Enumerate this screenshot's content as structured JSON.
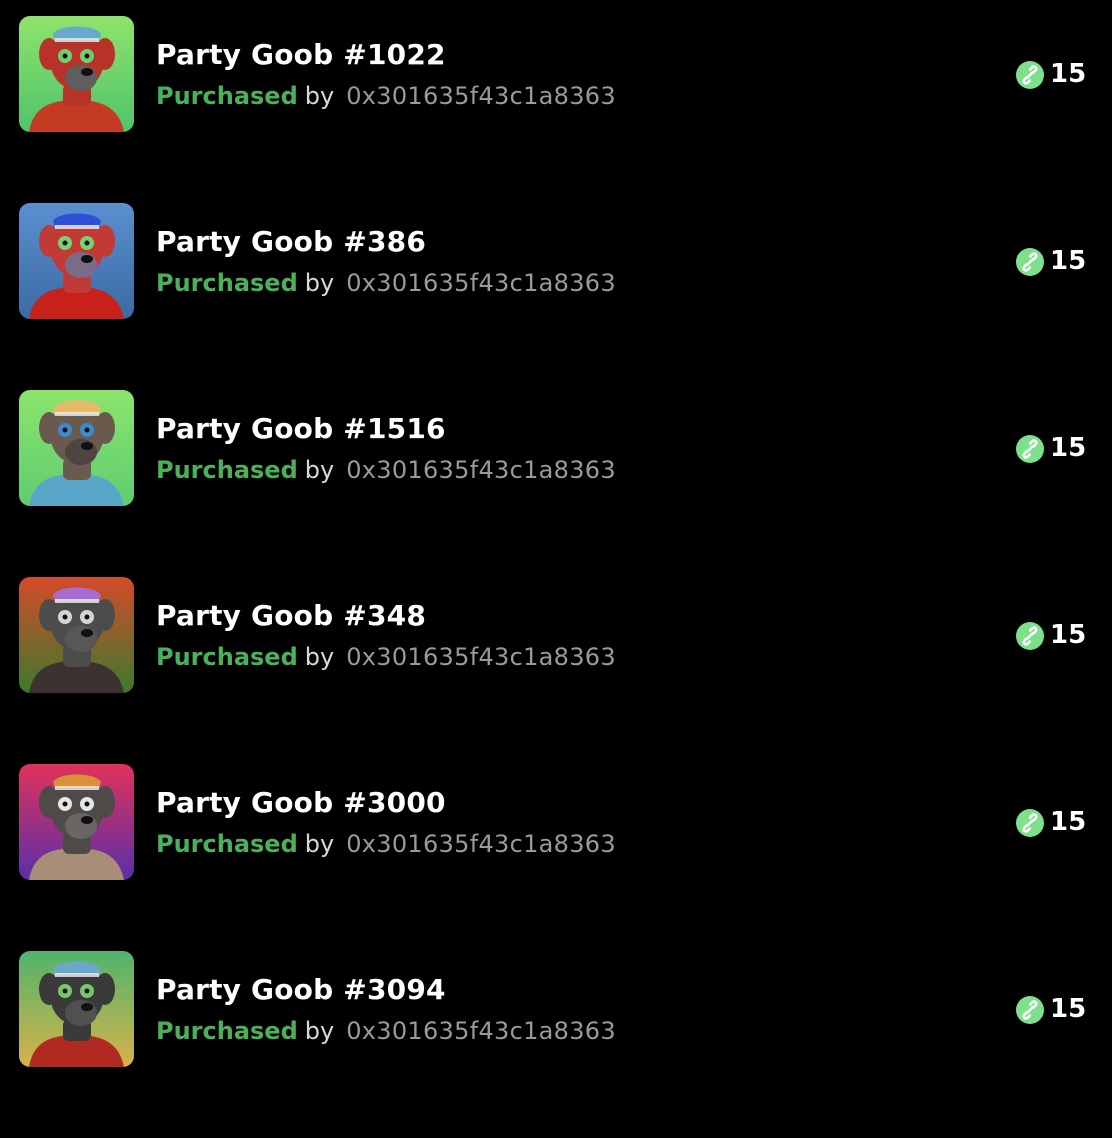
{
  "activity": [
    {
      "name": "Party Goob #1022",
      "status": "Purchased",
      "by": "by",
      "address": "0x301635f43c1a8363",
      "price": "15",
      "thumb": {
        "bg_top": "#8fe36a",
        "bg_bottom": "#4fc36d",
        "fur": "#b7332a",
        "face": "#5e5e5e",
        "outfit": "#c23b22",
        "eyes": "#6fcf6a",
        "hat": "#6aa7c9"
      }
    },
    {
      "name": "Party Goob #386",
      "status": "Purchased",
      "by": "by",
      "address": "0x301635f43c1a8363",
      "price": "15",
      "thumb": {
        "bg_top": "#5a8fd0",
        "bg_bottom": "#3c6aa4",
        "fur": "#c23a35",
        "face": "#7a6c88",
        "outfit": "#c8201a",
        "eyes": "#7ad070",
        "hat": "#2e4fd6"
      }
    },
    {
      "name": "Party Goob #1516",
      "status": "Purchased",
      "by": "by",
      "address": "0x301635f43c1a8363",
      "price": "15",
      "thumb": {
        "bg_top": "#8be56c",
        "bg_bottom": "#5fcc72",
        "fur": "#6a5a4e",
        "face": "#4e4442",
        "outfit": "#5aa6c8",
        "eyes": "#3a8bd0",
        "hat": "#e7b96a"
      }
    },
    {
      "name": "Party Goob #348",
      "status": "Purchased",
      "by": "by",
      "address": "0x301635f43c1a8363",
      "price": "15",
      "thumb": {
        "bg_top": "#d54a2a",
        "bg_bottom": "#3d7a2c",
        "fur": "#4c4c4c",
        "face": "#5a5656",
        "outfit": "#3c3230",
        "eyes": "#d4d4d4",
        "hat": "#a86bd1"
      }
    },
    {
      "name": "Party Goob #3000",
      "status": "Purchased",
      "by": "by",
      "address": "0x301635f43c1a8363",
      "price": "15",
      "thumb": {
        "bg_top": "#e0325c",
        "bg_bottom": "#5a2fa8",
        "fur": "#4e4a48",
        "face": "#6a6664",
        "outfit": "#a88e78",
        "eyes": "#e6e6e6",
        "hat": "#d9903a"
      }
    },
    {
      "name": "Party Goob #3094",
      "status": "Purchased",
      "by": "by",
      "address": "0x301635f43c1a8363",
      "price": "15",
      "thumb": {
        "bg_top": "#4fb46c",
        "bg_bottom": "#d8b24a",
        "fur": "#3a3a3a",
        "face": "#505050",
        "outfit": "#b02a22",
        "eyes": "#76c86a",
        "hat": "#6aa7c9"
      }
    }
  ],
  "colors": {
    "background": "#000000",
    "status_green": "#4caf5a",
    "coin": "#7ee08a",
    "address_gray": "#9a9a9a"
  },
  "icons": {
    "currency": "link-coin-icon"
  }
}
